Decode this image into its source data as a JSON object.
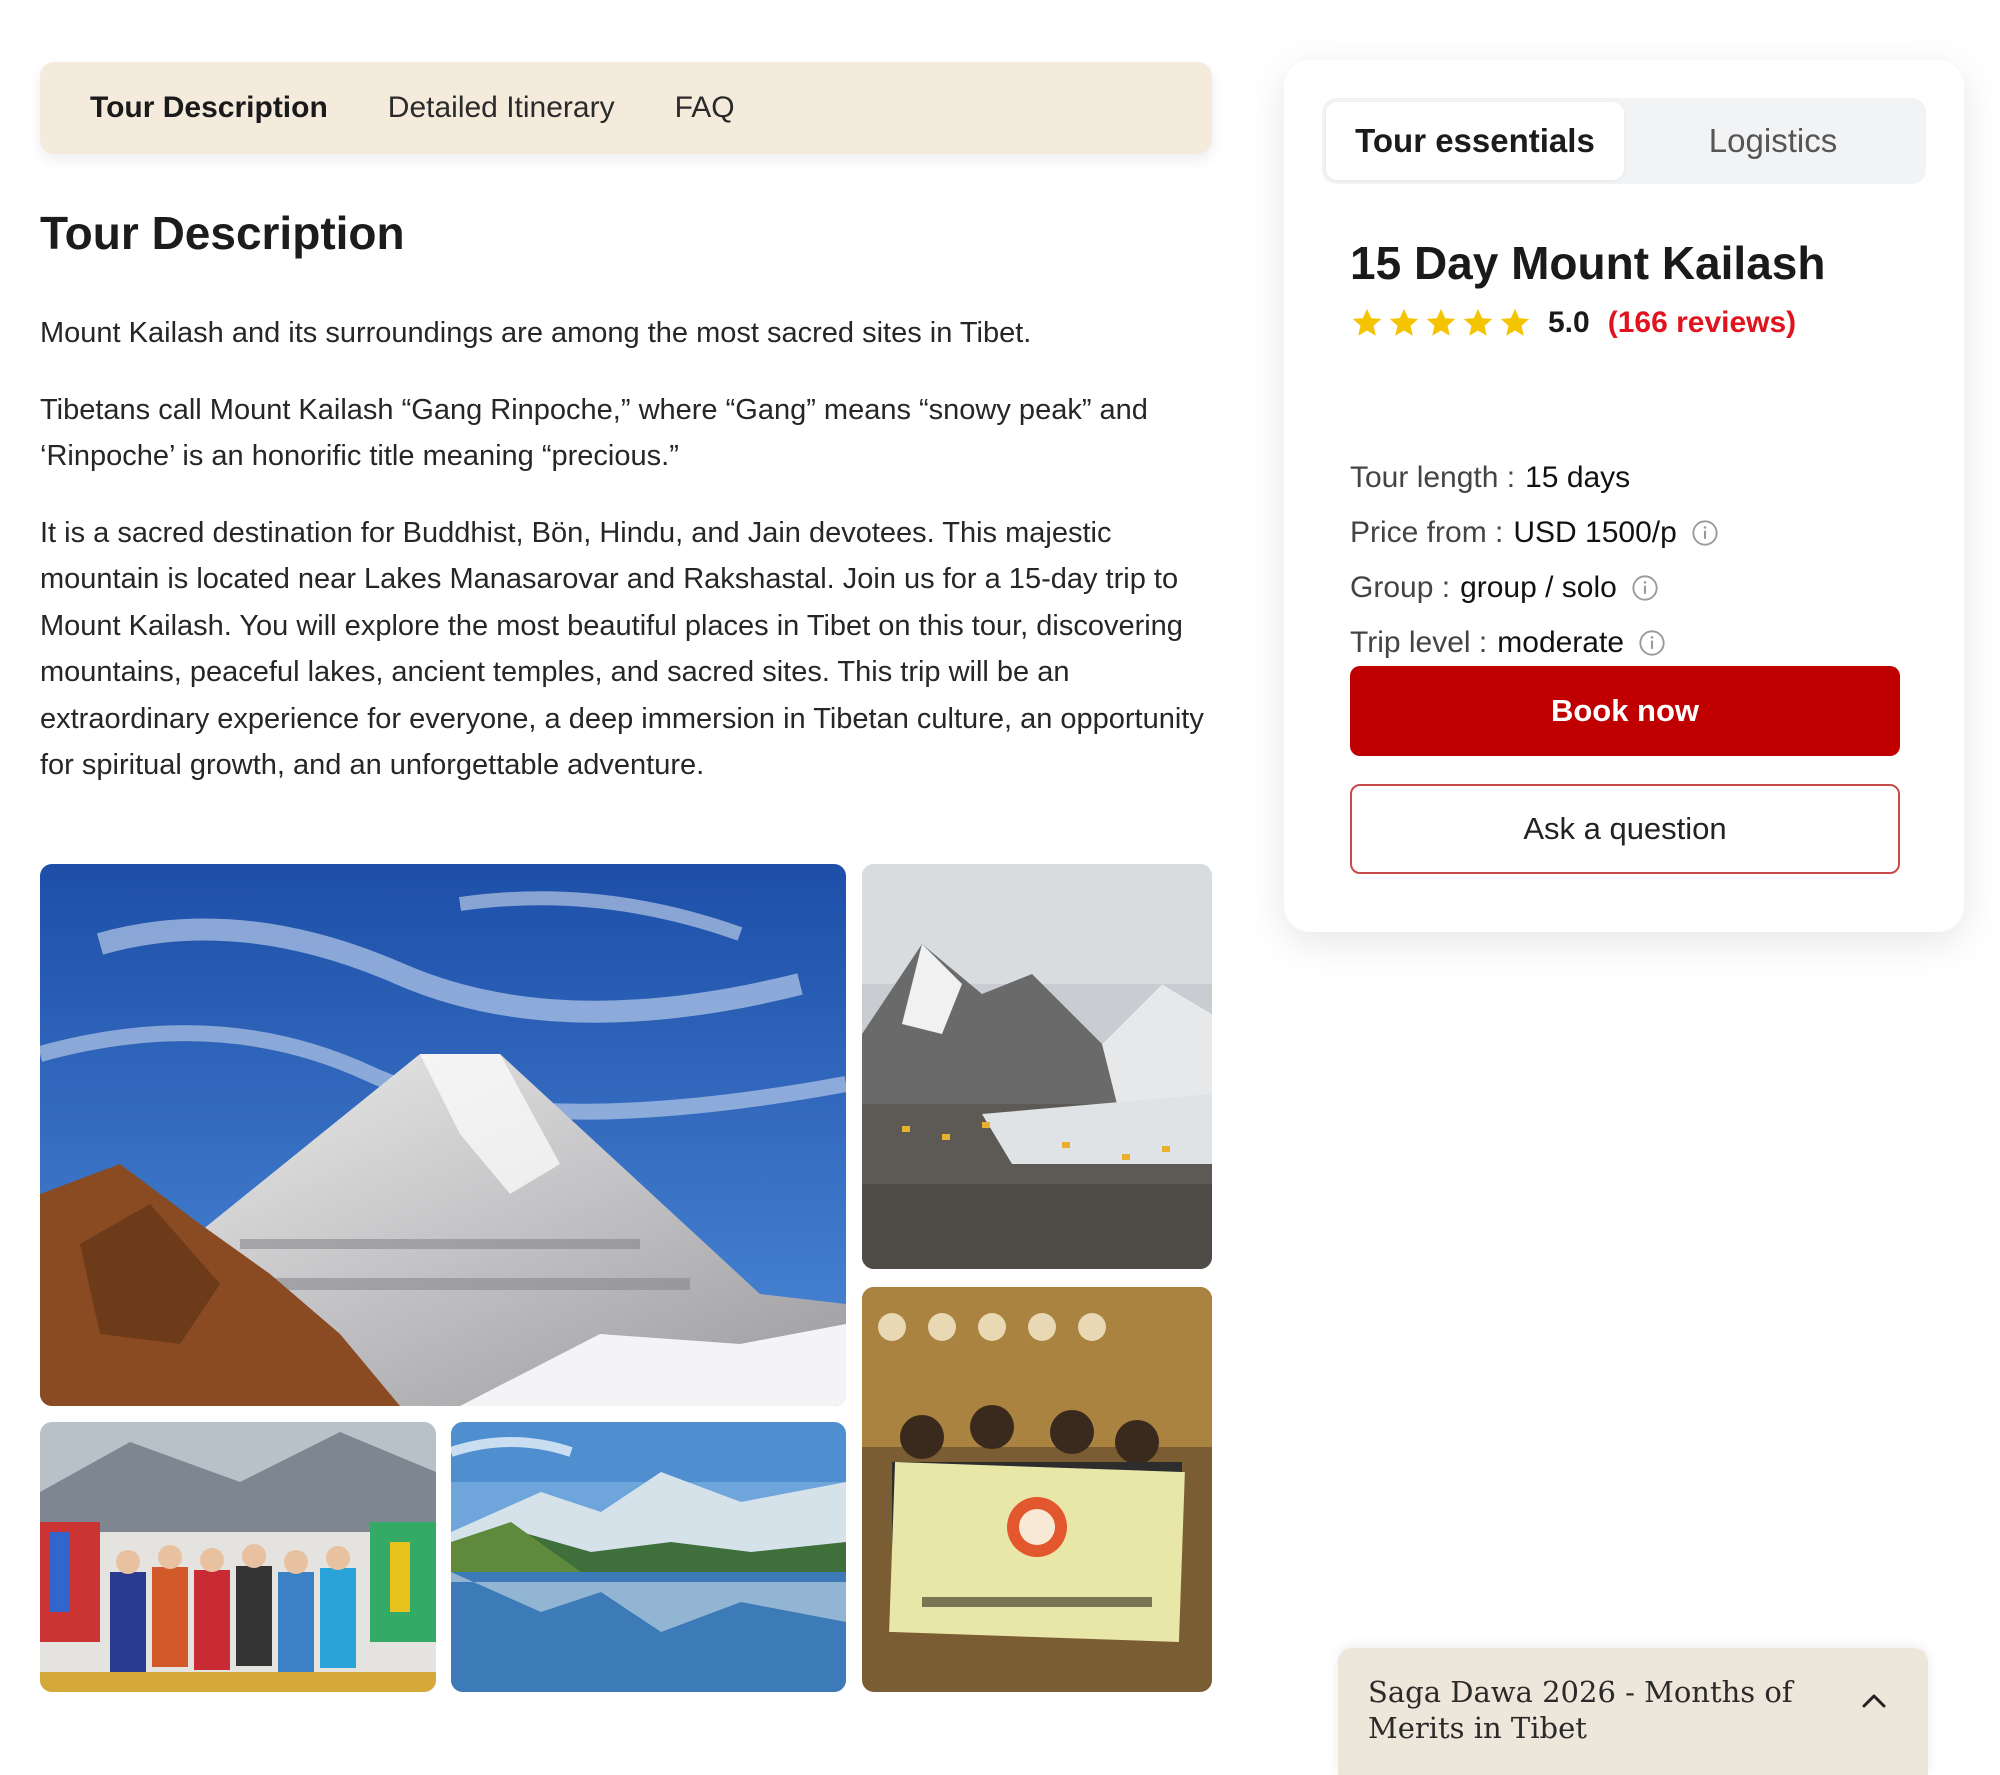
{
  "tabs": [
    {
      "label": "Tour Description",
      "active": true
    },
    {
      "label": "Detailed Itinerary",
      "active": false
    },
    {
      "label": "FAQ",
      "active": false
    }
  ],
  "section": {
    "title": "Tour Description",
    "paragraphs": [
      "Mount Kailash and its surroundings are among the most sacred sites in Tibet.",
      "Tibetans call Mount Kailash “Gang Rinpoche,” where “Gang” means “snowy peak” and ‘Rinpoche’ is an honorific title meaning “precious.”",
      "It is a sacred destination for Buddhist, Bön, Hindu, and Jain devotees. This majestic mountain is located near Lakes Manasarovar and Rakshastal. Join us for a 15-day trip to Mount Kailash. You will explore the most beautiful places in Tibet on this tour, discovering mountains, peaceful lakes, ancient temples, and sacred sites. This trip will be an extraordinary experience for everyone, a deep immersion in Tibetan culture, an opportunity for spiritual growth, and an unforgettable adventure."
    ]
  },
  "card": {
    "segments": [
      {
        "label": "Tour essentials",
        "active": true
      },
      {
        "label": "Logistics",
        "active": false
      }
    ],
    "title": "15 Day Mount Kailash",
    "rating": {
      "score": "5.0",
      "reviews": "(166 reviews)",
      "stars": 5
    },
    "facts": [
      {
        "label": "Tour length :",
        "value": "15 days",
        "info": false
      },
      {
        "label": "Price from :",
        "value": "USD 1500/p",
        "info": true
      },
      {
        "label": "Group :",
        "value": "group / solo",
        "info": true
      },
      {
        "label": "Trip level :",
        "value": "moderate",
        "info": true
      }
    ],
    "book_label": "Book now",
    "ask_label": "Ask a question"
  },
  "promo": {
    "text": "Saga Dawa 2026 - Months of Merits in Tibet"
  },
  "colors": {
    "accent": "#c00000",
    "tabbar_bg": "#f5ebdd",
    "star": "#f5c400",
    "reviews": "#e0141e"
  }
}
